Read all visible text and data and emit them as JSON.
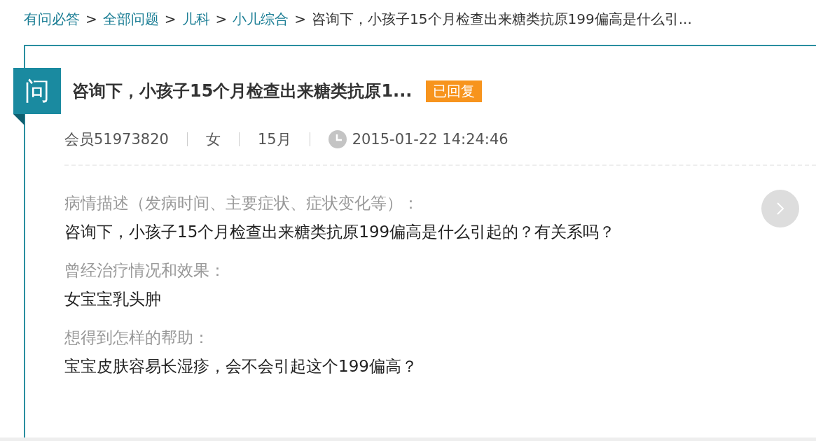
{
  "breadcrumb": [
    {
      "label": "有问必答",
      "link": true
    },
    {
      "separator": ">",
      "label": "全部问题",
      "link": true
    },
    {
      "separator": ">",
      "label": "儿科",
      "link": true
    },
    {
      "separator": ">",
      "label": "小儿综合",
      "link": true
    },
    {
      "separator": ">",
      "label": "咨询下，小孩子15个月检查出来糖类抗原199偏高是什么引...",
      "link": false
    }
  ],
  "question": {
    "badge": "问",
    "title": "咨询下，小孩子15个月检查出来糖类抗原1...",
    "status": "已回复",
    "meta": {
      "user": "会员51973820",
      "gender": "女",
      "age": "15月",
      "time": "2015-01-22 14:24:46"
    },
    "sections": [
      {
        "label": "病情描述（发病时间、主要症状、症状变化等）：",
        "text": "咨询下，小孩子15个月检查出来糖类抗原199偏高是什么引起的？有关系吗？"
      },
      {
        "label": "曾经治疗情况和效果：",
        "text": "女宝宝乳头肿"
      },
      {
        "label": "想得到怎样的帮助：",
        "text": "宝宝皮肤容易长湿疹，会不会引起这个199偏高？"
      }
    ]
  }
}
